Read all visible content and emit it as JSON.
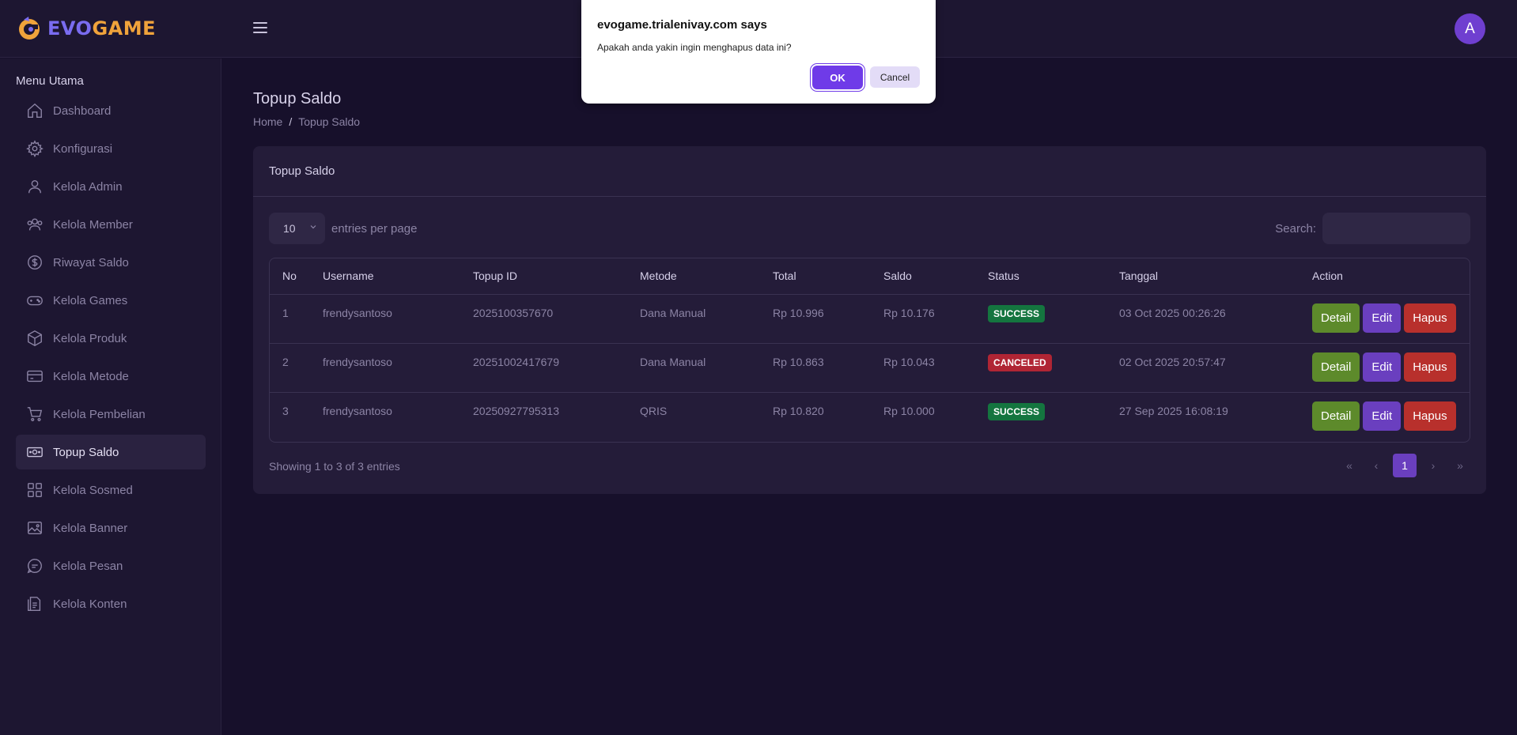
{
  "brand": {
    "name_part1": "EVO",
    "name_part2": "GAME"
  },
  "header": {
    "avatar_initial": "A"
  },
  "sidebar": {
    "heading": "Menu Utama",
    "items": [
      {
        "label": "Dashboard",
        "icon": "home-icon"
      },
      {
        "label": "Konfigurasi",
        "icon": "gear-icon"
      },
      {
        "label": "Kelola Admin",
        "icon": "user-icon"
      },
      {
        "label": "Kelola Member",
        "icon": "users-icon"
      },
      {
        "label": "Riwayat Saldo",
        "icon": "dollar-circle-icon"
      },
      {
        "label": "Kelola Games",
        "icon": "gamepad-icon"
      },
      {
        "label": "Kelola Produk",
        "icon": "box-icon"
      },
      {
        "label": "Kelola Metode",
        "icon": "credit-card-icon"
      },
      {
        "label": "Kelola Pembelian",
        "icon": "cart-icon"
      },
      {
        "label": "Topup Saldo",
        "icon": "money-icon",
        "active": true
      },
      {
        "label": "Kelola Sosmed",
        "icon": "grid-icon"
      },
      {
        "label": "Kelola Banner",
        "icon": "image-icon"
      },
      {
        "label": "Kelola Pesan",
        "icon": "chat-icon"
      },
      {
        "label": "Kelola Konten",
        "icon": "document-icon"
      }
    ]
  },
  "page": {
    "title": "Topup Saldo",
    "breadcrumb": {
      "home": "Home",
      "separator": "/",
      "current": "Topup Saldo"
    }
  },
  "card": {
    "title": "Topup Saldo",
    "entries_value": "10",
    "entries_label": "entries per page",
    "search_label": "Search:",
    "search_value": "",
    "columns": [
      "No",
      "Username",
      "Topup ID",
      "Metode",
      "Total",
      "Saldo",
      "Status",
      "Tanggal",
      "Action"
    ],
    "rows": [
      {
        "no": "1",
        "username": "frendysantoso",
        "topup_id": "2025100357670",
        "metode": "Dana Manual",
        "total": "Rp 10.996",
        "saldo": "Rp 10.176",
        "status": "SUCCESS",
        "tanggal": "03 Oct 2025 00:26:26"
      },
      {
        "no": "2",
        "username": "frendysantoso",
        "topup_id": "20251002417679",
        "metode": "Dana Manual",
        "total": "Rp 10.863",
        "saldo": "Rp 10.043",
        "status": "CANCELED",
        "tanggal": "02 Oct 2025 20:57:47"
      },
      {
        "no": "3",
        "username": "frendysantoso",
        "topup_id": "20250927795313",
        "metode": "QRIS",
        "total": "Rp 10.820",
        "saldo": "Rp 10.000",
        "status": "SUCCESS",
        "tanggal": "27 Sep 2025 16:08:19"
      }
    ],
    "action_labels": {
      "detail": "Detail",
      "edit": "Edit",
      "hapus": "Hapus"
    },
    "showing_text": "Showing 1 to 3 of 3 entries",
    "pagination": {
      "first": "«",
      "prev": "‹",
      "current": "1",
      "next": "›",
      "last": "»"
    }
  },
  "dialog": {
    "title": "evogame.trialenivay.com says",
    "message": "Apakah anda yakin ingin menghapus data ini?",
    "ok_label": "OK",
    "cancel_label": "Cancel"
  },
  "colors": {
    "accent": "#6a3fbf",
    "brand_orange": "#f0a33b",
    "success": "#14753f",
    "canceled": "#b02534"
  }
}
